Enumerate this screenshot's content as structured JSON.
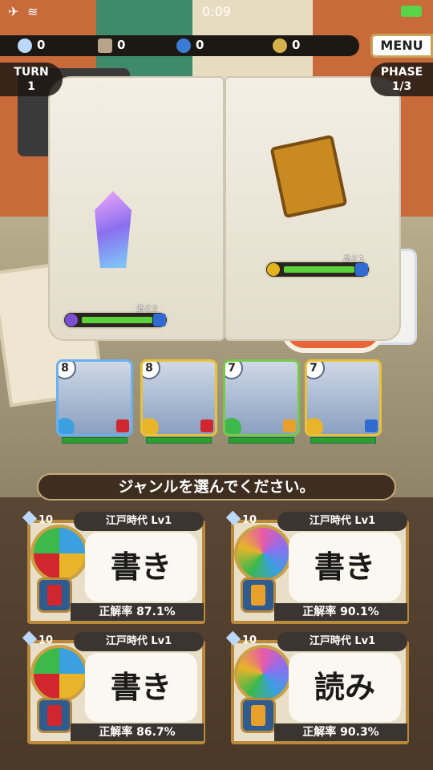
{
  "status_bar": {
    "time": "0:09"
  },
  "resources": [
    {
      "name": "diamond",
      "value": "0",
      "color": "#bcd8ff"
    },
    {
      "name": "chest",
      "value": "0",
      "color": "#b8a48a"
    },
    {
      "name": "potion",
      "value": "0",
      "color": "#3a7bd5"
    },
    {
      "name": "coin",
      "value": "0",
      "color": "#d6b04a"
    }
  ],
  "menu_label": "MENU",
  "turn": {
    "label": "TURN",
    "value": "1"
  },
  "phase": {
    "label": "PHASE",
    "value": "1/3"
  },
  "enemies": [
    {
      "name": "crystal",
      "remaining": "あと2",
      "hp_fraction": 1.0,
      "element_color": "#7a4fd0"
    },
    {
      "name": "chained-book",
      "remaining": "あと1",
      "hp_fraction": 1.0,
      "element_color": "#e3b41a"
    }
  ],
  "party": [
    {
      "level": "8",
      "border": "#6ab0f0",
      "element_color": "#3aa0e0",
      "skill_color": "#d0262e"
    },
    {
      "level": "8",
      "border": "#e8c23a",
      "element_color": "#e8b42a",
      "skill_color": "#d0262e"
    },
    {
      "level": "7",
      "border": "#78c84a",
      "element_color": "#3db84a",
      "skill_color": "#e8a02a"
    },
    {
      "level": "7",
      "border": "#e8c23a",
      "element_color": "#e8b42a",
      "skill_color": "#2f6bd0"
    }
  ],
  "prompt": "ジャンルを選んでください。",
  "genre_cards": [
    {
      "cost": "10",
      "genre": "江戸時代 Lv1",
      "word": "書き",
      "rate": "正解率 87.1%",
      "shield": "red"
    },
    {
      "cost": "10",
      "genre": "江戸時代 Lv1",
      "word": "書き",
      "rate": "正解率 90.1%",
      "shield": "gold"
    },
    {
      "cost": "10",
      "genre": "江戸時代 Lv1",
      "word": "書き",
      "rate": "正解率 86.7%",
      "shield": "red"
    },
    {
      "cost": "10",
      "genre": "江戸時代 Lv1",
      "word": "読み",
      "rate": "正解率 90.3%",
      "shield": "gold"
    }
  ]
}
